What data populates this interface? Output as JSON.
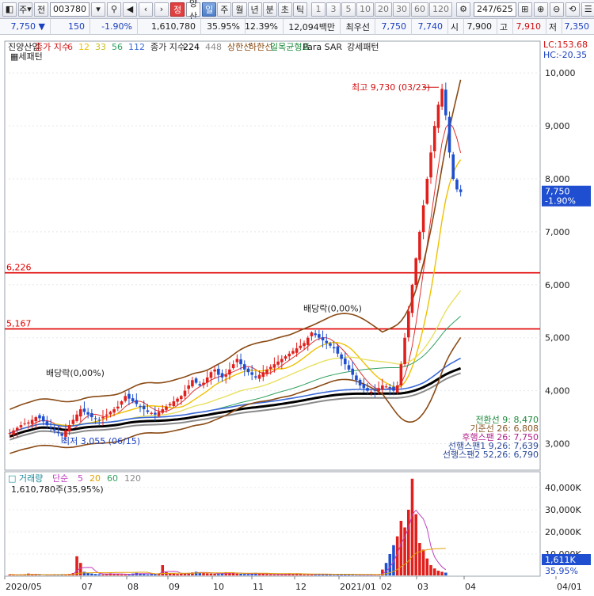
{
  "toolbar": {
    "market": "주",
    "prev": "전",
    "code": "003780",
    "name_badge": "정",
    "stock_name": "진양산업",
    "periods": [
      {
        "label": "일",
        "active": true
      },
      {
        "label": "주",
        "active": false
      },
      {
        "label": "월",
        "active": false
      },
      {
        "label": "년",
        "active": false
      },
      {
        "label": "분",
        "active": false
      },
      {
        "label": "초",
        "active": false
      },
      {
        "label": "틱",
        "active": false
      }
    ],
    "ranges": [
      "1",
      "3",
      "5",
      "10",
      "20",
      "30",
      "60",
      "120"
    ],
    "count": "247/625"
  },
  "quote": {
    "price": "7,750",
    "change": "150",
    "change_pct": "-1.90%",
    "volume": "1,610,780",
    "vol_ratio": "35.95%",
    "turnover": "12.39%",
    "amount": "12,094백만",
    "ask_label": "최우선",
    "ask": "7,750",
    "bid": "7,740",
    "open_label": "시",
    "open": "7,900",
    "high_label": "고",
    "high": "7,910",
    "low_label": "저",
    "low": "7,350"
  },
  "legend": {
    "stock": "진양산업",
    "ma_label": "종가 지수",
    "ma_periods": [
      "6",
      "12",
      "33",
      "56",
      "112"
    ],
    "ma2_label": "종가 지수",
    "ma2_periods": [
      "224",
      "448"
    ],
    "upper": "상한선",
    "lower": "하한선",
    "ichimoku": "일목균형표",
    "sar": "Para SAR",
    "strong": "강세패턴",
    "lc": "LC:153.68",
    "hc": "HC:-20.35"
  },
  "annotations": {
    "high": "최고 9,730 (03/23)",
    "low": "최저 3,055 (06/15)",
    "div1": "배당락(0,00%)",
    "div2": "배당락(0,00%)",
    "line1": "6,226",
    "line2": "5,167",
    "price_tag": "7,750",
    "price_tag_pct": "-1.90%"
  },
  "ichimoku_values": [
    {
      "label": "전환선 9: 8,470",
      "color": "#1b8a3a"
    },
    {
      "label": "기준선 26: 6,808",
      "color": "#8a5a2a"
    },
    {
      "label": "후행스팬 26: 7,750",
      "color": "#b0208a"
    },
    {
      "label": "선행스팬1 9,26: 7,639",
      "color": "#2c4a9a"
    },
    {
      "label": "선행스팬2 52,26: 6,790",
      "color": "#2c4a9a"
    }
  ],
  "volume_legend": {
    "title": "거래량",
    "ma_label": "단순",
    "periods": [
      "5",
      "20",
      "60",
      "120"
    ],
    "value": "1,610,780주(35,95%)",
    "tag": "1,611K",
    "tag_pct": "35.95%"
  },
  "x_labels": [
    "2020/05",
    "07",
    "08",
    "09",
    "10",
    "11",
    "12",
    "2021/01",
    "02",
    "03",
    "04",
    "04/01"
  ],
  "chart_data": [
    {
      "type": "candlestick",
      "title": "진양산업",
      "ylim": [
        2500,
        10600
      ],
      "yticks": [
        "10,000",
        "9,000",
        "8,000",
        "7,000",
        "6,000",
        "5,000",
        "4,000",
        "3,000"
      ],
      "horizontal_lines": [
        6226,
        5167
      ],
      "high": {
        "date": "03/23",
        "value": 9730
      },
      "low": {
        "date": "06/15",
        "value": 3055
      },
      "last": 7750,
      "close_series": [
        3200,
        3250,
        3300,
        3350,
        3380,
        3400,
        3450,
        3500,
        3480,
        3420,
        3350,
        3300,
        3250,
        3200,
        3150,
        3250,
        3350,
        3450,
        3550,
        3650,
        3600,
        3550,
        3500,
        3480,
        3450,
        3500,
        3550,
        3600,
        3650,
        3700,
        3800,
        3900,
        3850,
        3800,
        3750,
        3700,
        3650,
        3600,
        3580,
        3550,
        3600,
        3650,
        3700,
        3750,
        3800,
        3850,
        3900,
        4000,
        4100,
        4200,
        4150,
        4100,
        4150,
        4250,
        4350,
        4400,
        4300,
        4250,
        4300,
        4400,
        4500,
        4600,
        4500,
        4400,
        4350,
        4300,
        4250,
        4300,
        4350,
        4400,
        4450,
        4500,
        4550,
        4600,
        4650,
        4700,
        4750,
        4800,
        4850,
        4900,
        5000,
        5100,
        5050,
        5000,
        4950,
        4900,
        4850,
        4800,
        4700,
        4600,
        4500,
        4400,
        4300,
        4200,
        4100,
        4050,
        4000,
        3980,
        4000,
        4050,
        4100,
        4080,
        4050,
        4000,
        4100,
        4500,
        5000,
        5500,
        6000,
        6500,
        7000,
        7500,
        8000,
        8500,
        9000,
        9400,
        9700,
        9200,
        8500,
        8000,
        7800,
        7750
      ]
    },
    {
      "type": "bar",
      "title": "거래량",
      "ylim": [
        0,
        45000
      ],
      "yticks": [
        "40,000K",
        "30,000K",
        "20,000K",
        "10,000K"
      ],
      "note": "volume in thousand shares",
      "values": [
        800,
        600,
        500,
        700,
        900,
        1200,
        800,
        600,
        500,
        400,
        600,
        700,
        900,
        800,
        700,
        600,
        1000,
        1400,
        9000,
        6000,
        2000,
        1500,
        1200,
        1000,
        900,
        800,
        1100,
        1300,
        1000,
        900,
        800,
        700,
        900,
        1200,
        1500,
        1300,
        1000,
        800,
        900,
        1100,
        1300,
        5000,
        1800,
        1400,
        1200,
        1000,
        1100,
        1300,
        1500,
        1700,
        2000,
        1800,
        1500,
        1300,
        1200,
        1100,
        1000,
        1400,
        1800,
        1600,
        1300,
        1200,
        1100,
        1000,
        900,
        1200,
        1500,
        1300,
        1100,
        1000,
        900,
        800,
        700,
        900,
        1100,
        1300,
        1200,
        1000,
        900,
        800,
        700,
        800,
        900,
        1000,
        900,
        800,
        700,
        600,
        800,
        1000,
        900,
        700,
        600,
        500,
        600,
        700,
        800,
        700,
        600,
        500,
        3000,
        6000,
        10000,
        14000,
        18000,
        25000,
        22000,
        30000,
        44000,
        28000,
        15000,
        12000,
        8000,
        5000,
        3500,
        2500,
        2000,
        1611
      ]
    }
  ]
}
